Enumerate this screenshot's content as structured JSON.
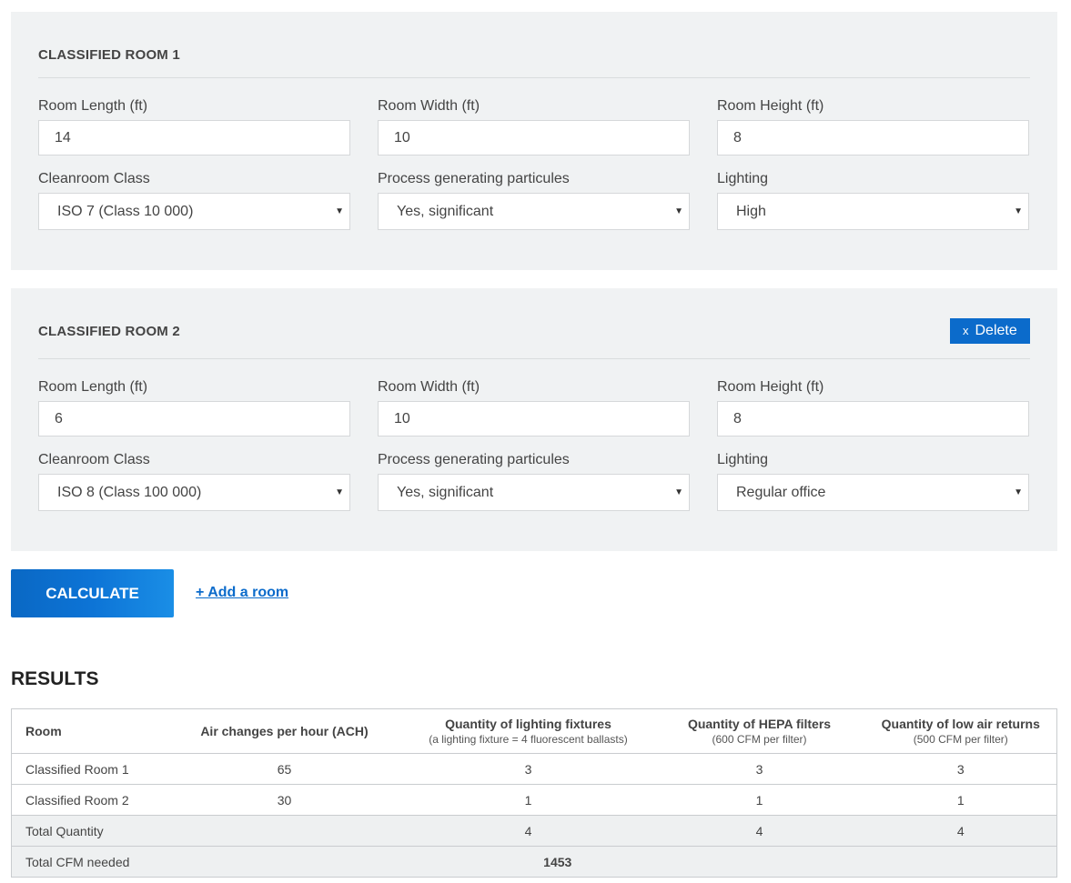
{
  "rooms": [
    {
      "title": "CLASSIFIED ROOM 1",
      "length_label": "Room Length (ft)",
      "length": "14",
      "width_label": "Room Width (ft)",
      "width": "10",
      "height_label": "Room Height (ft)",
      "height": "8",
      "class_label": "Cleanroom Class",
      "class": "ISO 7 (Class 10 000)",
      "process_label": "Process generating particules",
      "process": "Yes, significant",
      "lighting_label": "Lighting",
      "lighting": "High"
    },
    {
      "title": "CLASSIFIED ROOM 2",
      "delete_label": "Delete",
      "delete_x": "x",
      "length_label": "Room Length (ft)",
      "length": "6",
      "width_label": "Room Width (ft)",
      "width": "10",
      "height_label": "Room Height (ft)",
      "height": "8",
      "class_label": "Cleanroom Class",
      "class": "ISO 8 (Class 100 000)",
      "process_label": "Process generating particules",
      "process": "Yes, significant",
      "lighting_label": "Lighting",
      "lighting": "Regular office"
    }
  ],
  "select_arrow": "▼",
  "actions": {
    "calculate_label": "CALCULATE",
    "add_room_label": "+ Add a room"
  },
  "results": {
    "heading": "RESULTS",
    "headers": {
      "room": "Room",
      "ach": "Air changes per hour (ACH)",
      "lighting": "Quantity of lighting fixtures",
      "lighting_sub": "(a lighting fixture = 4 fluorescent ballasts)",
      "hepa": "Quantity of HEPA filters",
      "hepa_sub": "(600 CFM per filter)",
      "returns": "Quantity of low air returns",
      "returns_sub": "(500 CFM per filter)"
    },
    "rows": [
      {
        "room": "Classified Room 1",
        "ach": "65",
        "lighting": "3",
        "hepa": "3",
        "returns": "3"
      },
      {
        "room": "Classified Room 2",
        "ach": "30",
        "lighting": "1",
        "hepa": "1",
        "returns": "1"
      }
    ],
    "total_quantity": {
      "label": "Total Quantity",
      "lighting": "4",
      "hepa": "4",
      "returns": "4"
    },
    "total_cfm": {
      "label": "Total CFM needed",
      "value": "1453"
    }
  },
  "colors": {
    "panel_bg": "#f0f2f3",
    "accent_blue": "#0b6bcb"
  }
}
